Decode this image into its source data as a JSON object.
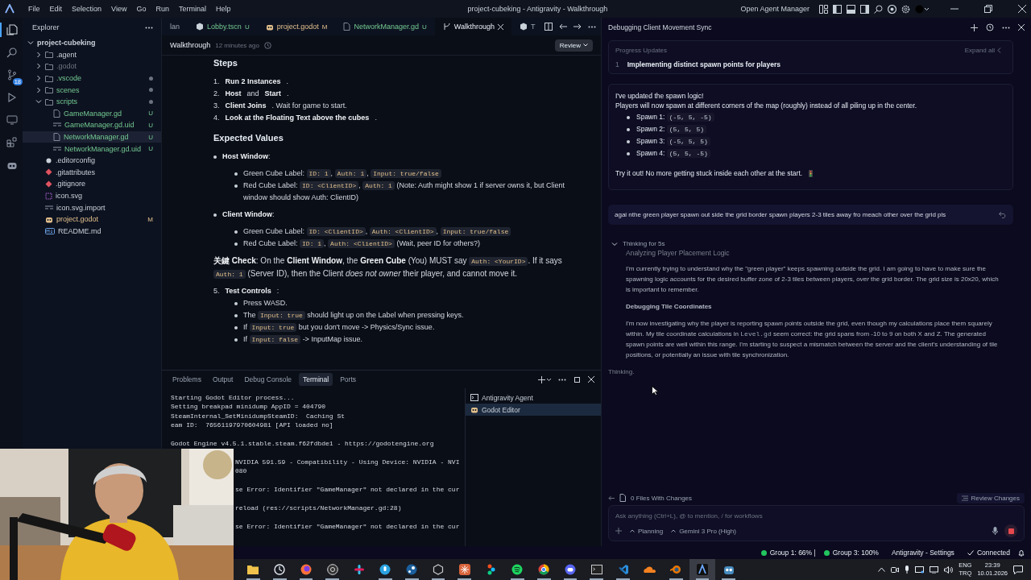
{
  "window": {
    "title": "project-cubeking - Antigravity - Walkthrough",
    "menu": [
      "File",
      "Edit",
      "Selection",
      "View",
      "Go",
      "Run",
      "Terminal",
      "Help"
    ],
    "agent_manager": "Open Agent Manager"
  },
  "activity_bar": [
    {
      "kind": "files",
      "selected": true
    },
    {
      "kind": "search",
      "selected": false
    },
    {
      "kind": "source-control",
      "selected": false,
      "badge": "18"
    },
    {
      "kind": "run",
      "selected": false
    },
    {
      "kind": "remote",
      "selected": false
    },
    {
      "kind": "extensions",
      "selected": false
    },
    {
      "kind": "godot",
      "selected": false
    }
  ],
  "explorer": {
    "title": "Explorer",
    "tree": [
      {
        "name": "project-cubeking",
        "kind": "root",
        "expanded": true,
        "children": [
          {
            "name": ".agent",
            "kind": "folder",
            "expanded": false,
            "untracked": false,
            "modified": false,
            "ignored": false
          },
          {
            "name": ".godot",
            "kind": "folder",
            "expanded": false,
            "untracked": false,
            "modified": false,
            "ignored": true
          },
          {
            "name": ".vscode",
            "kind": "folder",
            "expanded": false,
            "untracked": true,
            "modified": false,
            "ignored": false,
            "dot": true
          },
          {
            "name": "scenes",
            "kind": "folder",
            "expanded": false,
            "untracked": true,
            "modified": false,
            "ignored": false,
            "dot": true
          },
          {
            "name": "scripts",
            "kind": "folder",
            "expanded": true,
            "untracked": true,
            "modified": false,
            "ignored": false,
            "dot": true,
            "children": [
              {
                "name": "GameManager.gd",
                "kind": "file",
                "untracked": true,
                "modified": false,
                "ignored": false,
                "badge": "U",
                "selected": false
              },
              {
                "name": "GameManager.gd.uid",
                "kind": "uid",
                "untracked": true,
                "modified": false,
                "ignored": false,
                "badge": "U",
                "selected": false
              },
              {
                "name": "NetworkManager.gd",
                "kind": "file",
                "untracked": true,
                "modified": false,
                "ignored": false,
                "badge": "U",
                "selected": true
              },
              {
                "name": "NetworkManager.gd.uid",
                "kind": "uid",
                "untracked": true,
                "modified": false,
                "ignored": false,
                "badge": "U",
                "selected": false
              }
            ]
          },
          {
            "name": ".editorconfig",
            "kind": "config",
            "untracked": false,
            "modified": false,
            "ignored": false
          },
          {
            "name": ".gitattributes",
            "kind": "git",
            "untracked": false,
            "modified": false,
            "ignored": false
          },
          {
            "name": ".gitignore",
            "kind": "git",
            "untracked": false,
            "modified": false,
            "ignored": false
          },
          {
            "name": "icon.svg",
            "kind": "svg",
            "untracked": false,
            "modified": false,
            "ignored": false
          },
          {
            "name": "icon.svg.import",
            "kind": "uid",
            "untracked": false,
            "modified": false,
            "ignored": false
          },
          {
            "name": "project.godot",
            "kind": "godot",
            "untracked": false,
            "modified": true,
            "ignored": false,
            "badge": "M"
          },
          {
            "name": "README.md",
            "kind": "markdown",
            "untracked": false,
            "modified": false,
            "ignored": false
          }
        ]
      }
    ]
  },
  "tabs": [
    {
      "label": "lan",
      "kind": "plain",
      "untracked": false,
      "modified": false,
      "selected": false
    },
    {
      "label": "Lobby.tscn",
      "kind": "scene",
      "badge": "U",
      "untracked": true,
      "modified": false,
      "selected": false
    },
    {
      "label": "project.godot",
      "kind": "godot",
      "badge": "M",
      "untracked": false,
      "modified": true,
      "selected": false
    },
    {
      "label": "NetworkManager.gd",
      "kind": "file",
      "badge": "U",
      "untracked": true,
      "modified": false,
      "selected": false
    },
    {
      "label": "Walkthrough",
      "kind": "walkthrough",
      "untracked": false,
      "modified": false,
      "selected": true
    },
    {
      "label": "T",
      "kind": "scene",
      "untracked": false,
      "modified": false,
      "selected": false
    }
  ],
  "document": {
    "title": "Walkthrough",
    "time": "12 minutes ago",
    "review": "Review",
    "blocks": [
      {
        "kind": "heading",
        "parts": [
          {
            "text": "Steps"
          }
        ]
      },
      {
        "kind": "step",
        "parts": [
          {
            "text": "1. **Run 2 Instances**."
          }
        ]
      },
      {
        "kind": "step",
        "parts": [
          {
            "text": "2. **Host** and **Start**."
          }
        ]
      },
      {
        "kind": "step",
        "parts": [
          {
            "text": "3. **Client Joins**. Wait for game to start."
          }
        ]
      },
      {
        "kind": "step",
        "parts": [
          {
            "text": "4. **Look at the Floating Text above the cubes**."
          }
        ]
      },
      {
        "kind": "heading",
        "parts": [
          {
            "text": "Expected Values"
          }
        ]
      },
      {
        "kind": "bullet",
        "parts": [
          {
            "text": "**Host Window**:"
          }
        ]
      },
      {
        "kind": "subbullet",
        "parts": [
          {
            "text": "Green Cube Label: "
          },
          {
            "code": "ID: 1"
          },
          {
            "text": ", "
          },
          {
            "code": "Auth: 1"
          },
          {
            "text": ", "
          },
          {
            "code": "Input: true/false"
          }
        ]
      },
      {
        "kind": "subbullet",
        "parts": [
          {
            "text": "Red Cube Label: "
          },
          {
            "code": "ID: <ClientID>"
          },
          {
            "text": ", "
          },
          {
            "code": "Auth: 1"
          },
          {
            "text": " (Note: Auth might show 1 if server owns it, but Client window should show Auth: ClientID)"
          }
        ]
      },
      {
        "kind": "bullet",
        "parts": [
          {
            "text": "**Client Window**:"
          }
        ]
      },
      {
        "kind": "subbullet",
        "parts": [
          {
            "text": "Green Cube Label: "
          },
          {
            "code": "ID: <ClientID>"
          },
          {
            "text": ", "
          },
          {
            "code": "Auth: <ClientID>"
          },
          {
            "text": ", "
          },
          {
            "code": "Input: true/false"
          }
        ]
      },
      {
        "kind": "subbullet",
        "parts": [
          {
            "text": "Red Cube Label: "
          },
          {
            "code": "ID: 1"
          },
          {
            "text": ", "
          },
          {
            "code": "Auth: <ClientID>"
          },
          {
            "text": " (Wait, peer ID for others?)"
          }
        ]
      },
      {
        "kind": "para",
        "parts": [
          {
            "text": "**关鍵 Check**: On the **Client Window**, the **Green Cube** (You) MUST say "
          },
          {
            "code": "Auth: <YourID>"
          },
          {
            "text": ". If it says "
          },
          {
            "code": "Auth: 1"
          },
          {
            "text": " (Server ID), then the Client *does not owner* their player, and cannot move it."
          }
        ]
      },
      {
        "kind": "step",
        "parts": [
          {
            "text": "5. **Test Controls**:"
          }
        ]
      },
      {
        "kind": "subbullet",
        "parts": [
          {
            "text": "Press WASD."
          }
        ]
      },
      {
        "kind": "subbullet",
        "parts": [
          {
            "text": "The "
          },
          {
            "code": "Input: true"
          },
          {
            "text": " should light up on the Label when pressing keys."
          }
        ]
      },
      {
        "kind": "subbullet",
        "parts": [
          {
            "text": "If "
          },
          {
            "code": "Input: true"
          },
          {
            "text": " but you don't move -> Physics/Sync issue."
          }
        ]
      },
      {
        "kind": "subbullet",
        "parts": [
          {
            "text": "If "
          },
          {
            "code": "Input: false"
          },
          {
            "text": " -> InputMap issue."
          }
        ]
      }
    ]
  },
  "panel": {
    "tabs": [
      {
        "label": "Problems",
        "selected": false
      },
      {
        "label": "Output",
        "selected": false
      },
      {
        "label": "Debug Console",
        "selected": false
      },
      {
        "label": "Terminal",
        "selected": true
      },
      {
        "label": "Ports",
        "selected": false
      }
    ],
    "terminal_lines": [
      {
        "text": "Starting Godot Editor process...",
        "gap": false,
        "clipped": false
      },
      {
        "text": "Setting breakpad minidump AppID = 404790",
        "gap": false,
        "clipped": false
      },
      {
        "text": "SteamInternal_SetMinidumpSteamID:  Caching St",
        "gap": false,
        "clipped": false
      },
      {
        "text": "eam ID:  76561197970604981 [API loaded no]",
        "gap": false,
        "clipped": false
      },
      {
        "text": "Godot Engine v4.5.1.stable.steam.f62fdbde1 - https://godotengine.org",
        "gap": true,
        "clipped": false
      },
      {
        "text": "NVIDIA 591.59 - Compatibility - Using Device: NVIDIA - NVI",
        "gap": true,
        "clipped": true
      },
      {
        "text": "080",
        "gap": false,
        "clipped": true
      },
      {
        "text": "se Error: Identifier \"GameManager\" not declared in the cur",
        "gap": true,
        "clipped": true
      },
      {
        "text": "reload (res://scripts/NetworkManager.gd:28)",
        "gap": true,
        "clipped": true
      },
      {
        "text": "se Error: Identifier \"GameManager\" not declared in the cur",
        "gap": true,
        "clipped": true
      }
    ],
    "terminals": [
      {
        "label": "Antigravity Agent",
        "kind": "shell",
        "selected": false
      },
      {
        "label": "Godot Editor",
        "kind": "godot",
        "selected": true
      }
    ]
  },
  "agent": {
    "title": "Debugging Client Movement Sync",
    "progress": {
      "title": "Progress Updates",
      "expand": "Expand all",
      "step_number": "1",
      "step": "Implementing distinct spawn points for players"
    },
    "reply": [
      {
        "kind": "para",
        "parts": [
          {
            "text": "I've updated the spawn logic!"
          }
        ]
      },
      {
        "kind": "para",
        "parts": [
          {
            "text": "Players will now spawn at different corners of the map (roughly) instead of all piling up in the center."
          }
        ]
      },
      {
        "kind": "bullet",
        "parts": [
          {
            "text": "Spawn 1: "
          },
          {
            "code": "(-5, 5, -5)"
          }
        ]
      },
      {
        "kind": "bullet",
        "parts": [
          {
            "text": "Spawn 2: "
          },
          {
            "code": "(5, 5, 5)"
          }
        ]
      },
      {
        "kind": "bullet",
        "parts": [
          {
            "text": "Spawn 3: "
          },
          {
            "code": "(-5, 5, 5)"
          }
        ]
      },
      {
        "kind": "bullet",
        "parts": [
          {
            "text": "Spawn 4: "
          },
          {
            "code": "(5, 5, -5)"
          }
        ]
      },
      {
        "kind": "closing",
        "parts": [
          {
            "text": "Try it out! No more getting stuck inside each other at the start."
          }
        ]
      }
    ],
    "user_message": "agai nthe green player spawn out side the grid border spawn players 2-3 tiles away fro meach other over the grid pls",
    "thinking": {
      "label": "Thinking for 5s",
      "expanded": true,
      "blocks": [
        {
          "kind": "faded_heading",
          "parts": [
            {
              "text": "Analyzing Player Placement Logic"
            }
          ]
        },
        {
          "kind": "para",
          "parts": [
            {
              "text": "I'm currently trying to understand why the \"green player\" keeps spawning outside the grid. I am going to have to make sure the spawning logic accounts for the desired buffer zone of 2-3 tiles between players, *over* the grid border. The grid size is 20x20, which is important to remember."
            }
          ]
        },
        {
          "kind": "heading",
          "parts": [
            {
              "text": "Debugging Tile Coordinates"
            }
          ]
        },
        {
          "kind": "para",
          "parts": [
            {
              "text": "I'm now investigating why the player is reporting spawn points outside the grid, even though my calculations place them squarely within. My tile coordinate calculations in "
            },
            {
              "code": "Level.gd"
            },
            {
              "text": " seem correct: the grid spans from -10 to 9 on both X and Z. The generated spawn points are well within this range. I'm starting to suspect a mismatch between the server and the client's understanding of tile positions, or potentially an issue with tile synchronization."
            }
          ]
        }
      ]
    },
    "status": "Thinking.",
    "files_changed": "0 Files With Changes",
    "review_changes": "Review Changes",
    "input": {
      "placeholder": "Ask anything (Ctrl+L), @ to mention, / for workflows",
      "mode": "Planning",
      "model": "Gemini 3 Pro (High)"
    }
  },
  "status_bar": {
    "groups": [
      {
        "label": "Group 1: 66% |",
        "color": "#22c55e"
      },
      {
        "label": "Group 3: 100%",
        "color": "#22c55e"
      }
    ],
    "settings": "Antigravity - Settings",
    "connection": "Connected"
  },
  "taskbar": {
    "apps": [
      {
        "kind": "folder",
        "running": true,
        "selected": false
      },
      {
        "kind": "clock",
        "running": true,
        "selected": false
      },
      {
        "kind": "fox",
        "running": true,
        "selected": false
      },
      {
        "kind": "aperture",
        "running": true,
        "selected": false
      },
      {
        "kind": "pinwheel",
        "running": false,
        "selected": false
      },
      {
        "kind": "microphone",
        "running": true,
        "selected": false
      },
      {
        "kind": "gear-wheel",
        "running": true,
        "selected": false
      },
      {
        "kind": "cube",
        "running": true,
        "selected": false
      },
      {
        "kind": "starburst",
        "running": true,
        "selected": false
      },
      {
        "kind": "shapes",
        "running": false,
        "selected": false
      },
      {
        "kind": "waves",
        "running": true,
        "selected": false
      },
      {
        "kind": "ring",
        "running": true,
        "selected": false
      },
      {
        "kind": "gamepad",
        "running": true,
        "selected": false
      },
      {
        "kind": "terminal",
        "running": true,
        "selected": false
      },
      {
        "kind": "ribbon",
        "running": true,
        "selected": false
      },
      {
        "kind": "cloud",
        "running": false,
        "selected": false
      },
      {
        "kind": "eye",
        "running": true,
        "selected": false
      },
      {
        "kind": "peak",
        "running": true,
        "selected": true
      },
      {
        "kind": "robot",
        "running": true,
        "selected": false
      }
    ],
    "language": "ENG",
    "layout": "TRQ",
    "time": "23:39",
    "date": "10.01.2026"
  }
}
